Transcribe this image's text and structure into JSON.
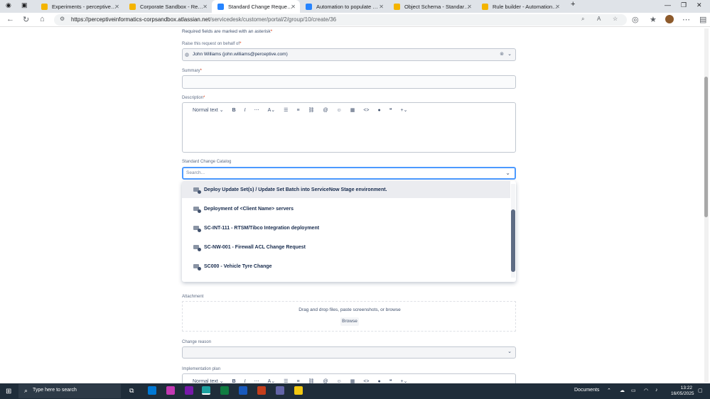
{
  "browser": {
    "tabs": [
      {
        "title": "Experiments - perceptiveinforma",
        "color": "#f4b400"
      },
      {
        "title": "Corporate Sandbox - Request typ",
        "color": "#f4b400"
      },
      {
        "title": "Standard Change Request - Corp",
        "color": "#2684ff"
      },
      {
        "title": "Automation to populate work ite",
        "color": "#2684ff"
      },
      {
        "title": "Object Schema - Standard Chang",
        "color": "#f4b400"
      },
      {
        "title": "Rule builder - Automation - Corp",
        "color": "#f4b400"
      }
    ],
    "url_host": "https://perceptiveinformatics-corpsandbox.atlassian.net",
    "url_path": "/servicedesk/customer/portal/2/group/10/create/36"
  },
  "form": {
    "required_note": "Required fields are marked with an asterisk",
    "raise_on_behalf_label": "Raise this request on behalf of",
    "raise_on_behalf_value": "John Williams (john.williams@perceptive.com)",
    "summary_label": "Summary",
    "description_label": "Description",
    "rte_style": "Normal text",
    "catalog_label": "Standard Change Catalog",
    "catalog_placeholder": "Search...",
    "attachment_label": "Attachment",
    "attachment_drop": "Drag and drop files, paste screenshots, or browse",
    "browse_label": "Browse",
    "change_reason_label": "Change reason",
    "implementation_plan_label": "Implementation plan",
    "asterisk": "*"
  },
  "dropdown": {
    "options": [
      "Deploy Update Set(s) / Update Set Batch into ServiceNow Stage environment.",
      "Deployment of <Client Name> servers",
      "SC-INT-111 - RTSM/Tibco Integration deployment",
      "SC-NW-001 - Firewall ACL Change Request",
      "SC000 - Vehicle Tyre Change"
    ]
  },
  "taskbar": {
    "search_placeholder": "Type here to search",
    "documents_label": "Documents",
    "time": "13:22",
    "date": "16/05/2025"
  }
}
